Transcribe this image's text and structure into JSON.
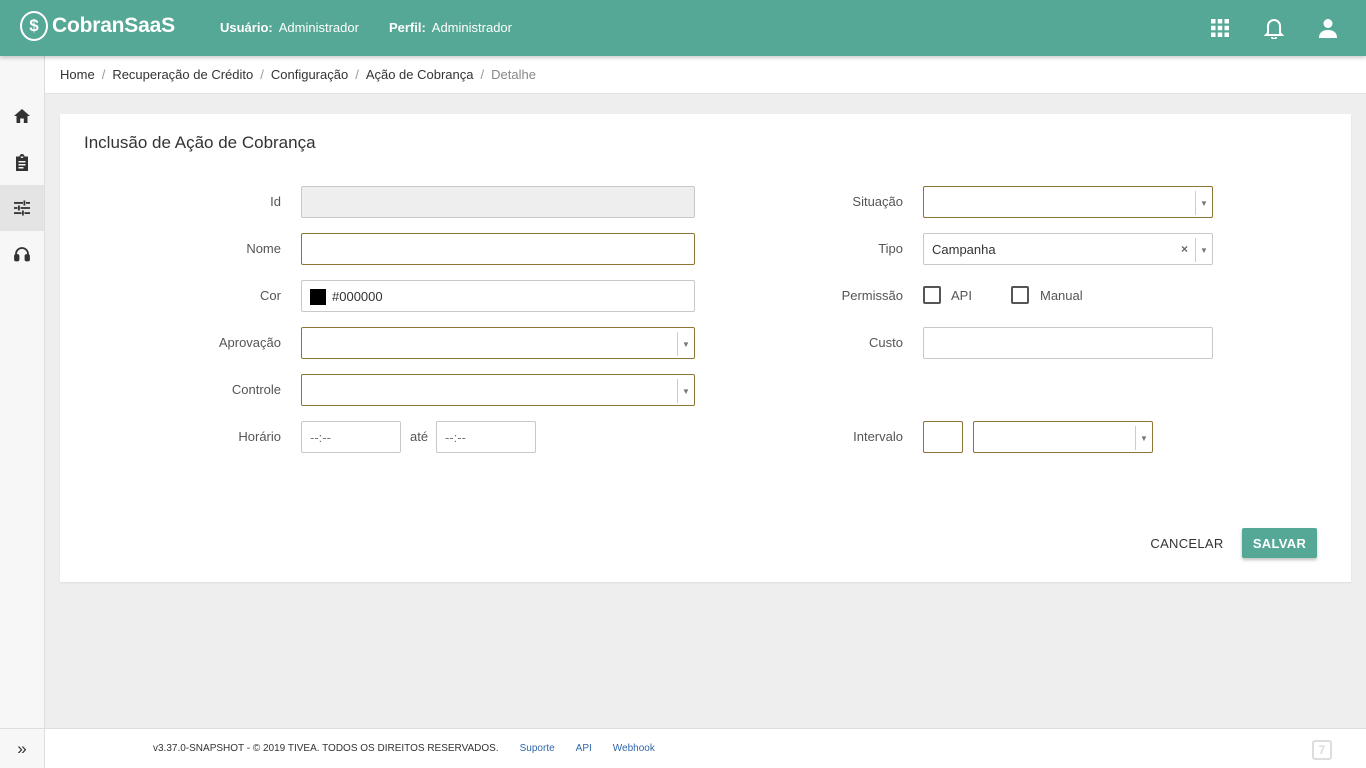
{
  "header": {
    "logo_text": "CobranSaaS",
    "user_label": "Usuário:",
    "user_value": "Administrador",
    "profile_label": "Perfil:",
    "profile_value": "Administrador",
    "icons": [
      "apps-grid-icon",
      "bell-icon",
      "account-icon"
    ]
  },
  "sidebar": {
    "items": [
      "home-icon",
      "clipboard-icon",
      "tune-icon",
      "headset-icon"
    ],
    "active": "tune-icon",
    "expand_icon": "»"
  },
  "breadcrumb": {
    "items": [
      "Home",
      "Recuperação de Crédito",
      "Configuração",
      "Ação de Cobrança"
    ],
    "current": "Detalhe",
    "separator": "/"
  },
  "form": {
    "title": "Inclusão de Ação de Cobrança",
    "id_label": "Id",
    "id_value": "",
    "nome_label": "Nome",
    "nome_value": "",
    "cor_label": "Cor",
    "cor_value": "#000000",
    "aprovacao_label": "Aprovação",
    "aprovacao_value": "",
    "controle_label": "Controle",
    "controle_value": "",
    "horario_label": "Horário",
    "horario_start_placeholder": "--:--",
    "horario_sep": "até",
    "horario_end_placeholder": "--:--",
    "situacao_label": "Situação",
    "situacao_value": "",
    "tipo_label": "Tipo",
    "tipo_value": "Campanha",
    "tipo_clear": "×",
    "permissao_label": "Permissão",
    "permissao_api_label": "API",
    "permissao_api_checked": false,
    "permissao_manual_label": "Manual",
    "permissao_manual_checked": false,
    "custo_label": "Custo",
    "custo_value": "",
    "intervalo_label": "Intervalo",
    "intervalo_value": "",
    "intervalo_unit": "",
    "dropdown_arrow": "▼"
  },
  "actions": {
    "cancel_label": "CANCELAR",
    "save_label": "SALVAR"
  },
  "footer": {
    "copyright": "v3.37.0-SNAPSHOT - © 2019 TIVEA. TODOS OS DIREITOS RESERVADOS.",
    "links": [
      "Suporte",
      "API",
      "Webhook"
    ],
    "logo_char": "7"
  },
  "colors": {
    "primary": "#55a796",
    "input_border": "#8d7437",
    "link": "#2f67a8"
  }
}
